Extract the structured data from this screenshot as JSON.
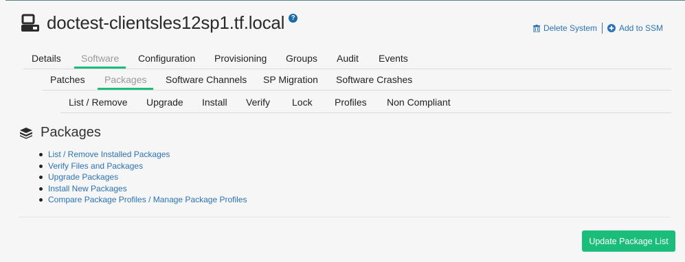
{
  "header": {
    "title": "doctest-clientsles12sp1.tf.local",
    "help_glyph": "?",
    "system_icon": "server-icon"
  },
  "actions": {
    "delete_label": "Delete System",
    "ssm_label": "Add to SSM"
  },
  "tabs_main": [
    {
      "label": "Details"
    },
    {
      "label": "Software",
      "active": true
    },
    {
      "label": "Configuration"
    },
    {
      "label": "Provisioning"
    },
    {
      "label": "Groups"
    },
    {
      "label": "Audit"
    },
    {
      "label": "Events"
    }
  ],
  "tabs_software": [
    {
      "label": "Patches"
    },
    {
      "label": "Packages",
      "active": true
    },
    {
      "label": "Software Channels"
    },
    {
      "label": "SP Migration"
    },
    {
      "label": "Software Crashes"
    }
  ],
  "tabs_packages": [
    {
      "label": "List / Remove"
    },
    {
      "label": "Upgrade"
    },
    {
      "label": "Install"
    },
    {
      "label": "Verify"
    },
    {
      "label": "Lock"
    },
    {
      "label": "Profiles"
    },
    {
      "label": "Non Compliant"
    }
  ],
  "section": {
    "title": "Packages",
    "icon": "packages-icon"
  },
  "links": [
    "List / Remove Installed Packages",
    "Verify Files and Packages",
    "Upgrade Packages",
    "Install New Packages",
    "Compare Package Profiles / Manage Package Profiles"
  ],
  "button": {
    "label": "Update Package List"
  },
  "colors": {
    "accent": "#1abc7a",
    "link": "#2a72b5",
    "background": "#f6f6f6"
  }
}
